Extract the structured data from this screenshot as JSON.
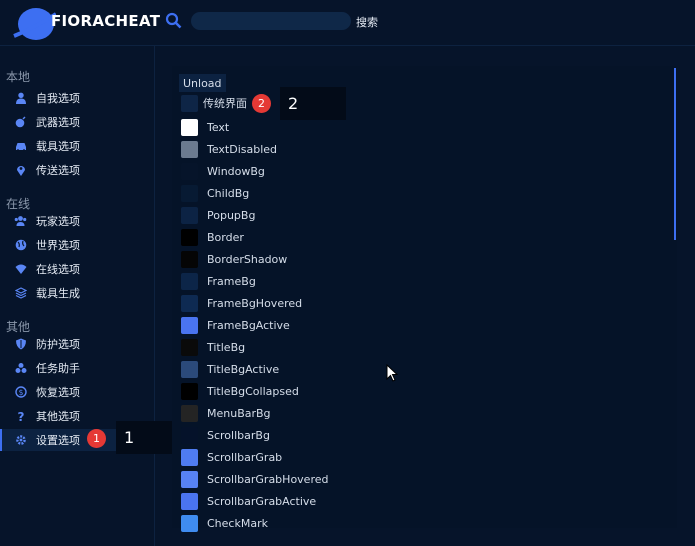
{
  "app": {
    "title": "FIORACHEAT"
  },
  "search": {
    "placeholder": "",
    "button_label": "搜索"
  },
  "sidebar": {
    "sections": [
      {
        "title": "本地",
        "items": [
          {
            "label": "自我选项",
            "icon": "user-icon"
          },
          {
            "label": "武器选项",
            "icon": "bomb-icon"
          },
          {
            "label": "载具选项",
            "icon": "car-icon"
          },
          {
            "label": "传送选项",
            "icon": "map-pin-icon"
          }
        ]
      },
      {
        "title": "在线",
        "items": [
          {
            "label": "玩家选项",
            "icon": "users-icon"
          },
          {
            "label": "世界选项",
            "icon": "globe-icon"
          },
          {
            "label": "在线选项",
            "icon": "wifi-icon"
          },
          {
            "label": "载具生成",
            "icon": "layers-icon"
          }
        ]
      },
      {
        "title": "其他",
        "items": [
          {
            "label": "防护选项",
            "icon": "shield-icon"
          },
          {
            "label": "任务助手",
            "icon": "biohazard-icon"
          },
          {
            "label": "恢复选项",
            "icon": "dollar-icon"
          },
          {
            "label": "其他选项",
            "icon": "question-icon"
          },
          {
            "label": "设置选项",
            "icon": "gear-icon"
          }
        ]
      }
    ]
  },
  "annotations": [
    {
      "badge": "1",
      "callout": "1"
    },
    {
      "badge": "2",
      "callout": "2"
    }
  ],
  "panel": {
    "unload_label": "Unload",
    "theme_label": "传统界面",
    "colors": [
      {
        "label": "Text",
        "color": "#ffffff"
      },
      {
        "label": "TextDisabled",
        "color": "#6b7a8f"
      },
      {
        "label": "WindowBg",
        "color": "#06142a"
      },
      {
        "label": "ChildBg",
        "color": "#071a33"
      },
      {
        "label": "PopupBg",
        "color": "#0c2344"
      },
      {
        "label": "Border",
        "color": "#000000"
      },
      {
        "label": "BorderShadow",
        "color": "#050505"
      },
      {
        "label": "FrameBg",
        "color": "#0c2548"
      },
      {
        "label": "FrameBgHovered",
        "color": "#0e2a52"
      },
      {
        "label": "FrameBgActive",
        "color": "#4a74f0"
      },
      {
        "label": "TitleBg",
        "color": "#0a0a0a"
      },
      {
        "label": "TitleBgActive",
        "color": "#2b4a7a"
      },
      {
        "label": "TitleBgCollapsed",
        "color": "#000000"
      },
      {
        "label": "MenuBarBg",
        "color": "#242424"
      },
      {
        "label": "ScrollbarBg",
        "color": "#05122a"
      },
      {
        "label": "ScrollbarGrab",
        "color": "#4f7cf2"
      },
      {
        "label": "ScrollbarGrabHovered",
        "color": "#5782f3"
      },
      {
        "label": "ScrollbarGrabActive",
        "color": "#4a74f0"
      },
      {
        "label": "CheckMark",
        "color": "#3f8cf0"
      }
    ]
  },
  "theme": {
    "accent": "#3d6ff2",
    "badge": "#e53935",
    "background": "#06142a"
  }
}
